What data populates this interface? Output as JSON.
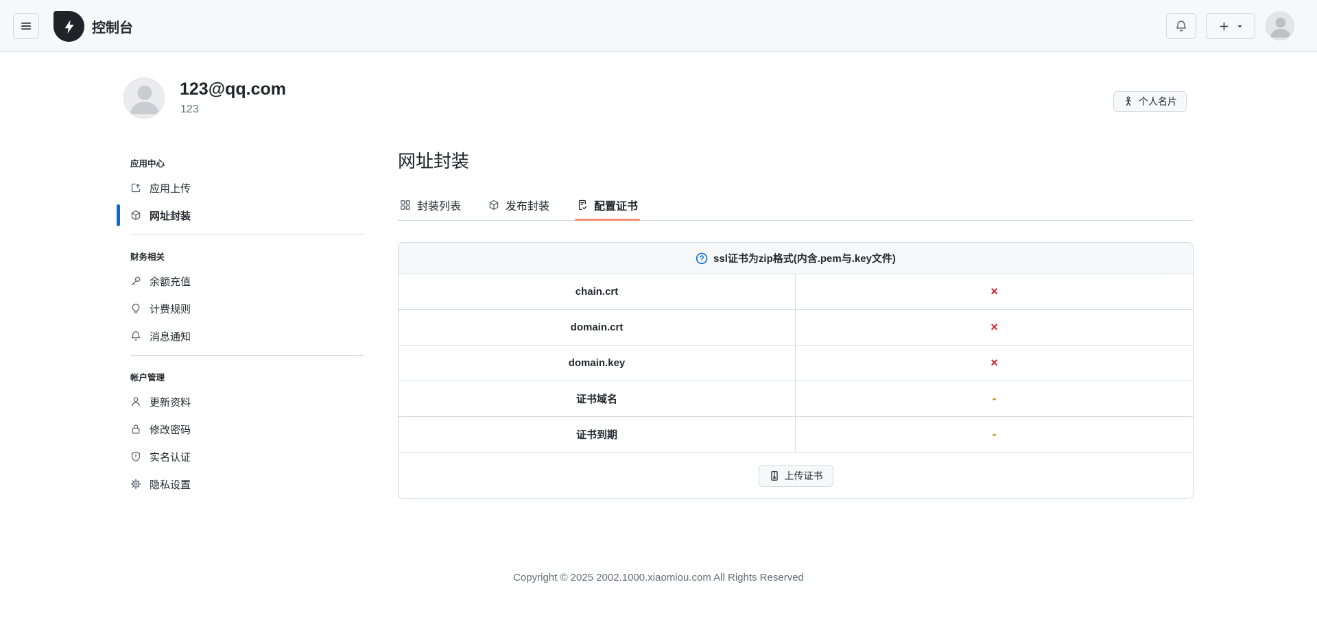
{
  "colors": {
    "topbar_bg": "#f6f8fa",
    "border": "#d0d7de",
    "text": "#1f2328",
    "muted": "#636c76",
    "accent_blue": "#0969da",
    "tab_underline": "#fd8c73",
    "danger_red": "#d1242f",
    "warning_gold": "#bf8700",
    "logo_bg": "#1f2328"
  },
  "topbar": {
    "menu_icon": "hamburger-icon",
    "logo_icon": "lightning-bolt-icon",
    "title": "控制台",
    "bell_icon": "bell-icon",
    "plus_icon": "plus-icon",
    "caret_icon": "caret-down-icon",
    "avatar_icon": "person-silhouette-icon"
  },
  "profile": {
    "avatar_icon": "person-silhouette-icon",
    "email": "123@qq.com",
    "username": "123",
    "card_button": {
      "label": "个人名片",
      "icon": "person-card-icon"
    }
  },
  "sidebar": {
    "sections": [
      {
        "header": "应用中心",
        "items": [
          {
            "label": "应用上传",
            "icon": "upload-icon",
            "active": false
          },
          {
            "label": "网址封装",
            "icon": "package-icon",
            "active": true
          }
        ]
      },
      {
        "header": "财务相关",
        "items": [
          {
            "label": "余额充值",
            "icon": "key-icon",
            "active": false
          },
          {
            "label": "计费规则",
            "icon": "lightbulb-icon",
            "active": false
          },
          {
            "label": "消息通知",
            "icon": "bell-icon",
            "active": false
          }
        ]
      },
      {
        "header": "帐户管理",
        "items": [
          {
            "label": "更新资料",
            "icon": "person-icon",
            "active": false
          },
          {
            "label": "修改密码",
            "icon": "lock-icon",
            "active": false
          },
          {
            "label": "实名认证",
            "icon": "shield-icon",
            "active": false
          },
          {
            "label": "隐私设置",
            "icon": "gear-icon",
            "active": false
          }
        ]
      }
    ]
  },
  "main": {
    "page_title": "网址封装",
    "tabs": [
      {
        "label": "封装列表",
        "icon": "apps-icon",
        "active": false
      },
      {
        "label": "发布封装",
        "icon": "package-icon",
        "active": false
      },
      {
        "label": "配置证书",
        "icon": "file-check-icon",
        "active": true
      }
    ],
    "certificate_panel": {
      "notice": "ssl证书为zip格式(内含.pem与.key文件)",
      "notice_icon": "question-circle-icon",
      "rows": [
        {
          "label": "chain.crt",
          "value": "×",
          "status": "missing"
        },
        {
          "label": "domain.crt",
          "value": "×",
          "status": "missing"
        },
        {
          "label": "domain.key",
          "value": "×",
          "status": "missing"
        },
        {
          "label": "证书域名",
          "value": "-",
          "status": "empty"
        },
        {
          "label": "证书到期",
          "value": "-",
          "status": "empty"
        }
      ],
      "upload_button": {
        "label": "上传证书",
        "icon": "zip-file-icon"
      }
    }
  },
  "footer": {
    "copyright": "Copyright © 2025 2002.1000.xiaomiou.com All Rights Reserved"
  }
}
